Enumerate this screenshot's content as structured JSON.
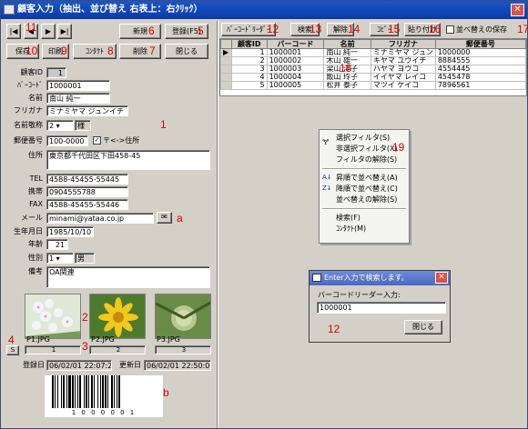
{
  "window": {
    "title": "顧客入力（抽出、並び替え 右表上：右ｸﾘｯｸ）"
  },
  "toolbar": {
    "save": "保存",
    "print": "印刷",
    "contact": "ｺﾝﾀｸﾄ",
    "new": "新規",
    "register": "登録(F5)",
    "delete": "削除",
    "close": "閉じる"
  },
  "right_toolbar": {
    "barcode_reader": "ﾊﾞｰｺｰﾄﾞﾘｰﾀﾞｰ",
    "search": "検索",
    "release": "解除",
    "copy": "ｺﾋﾟｰ",
    "paste": "貼り付け",
    "sort_keep": "並べ替えの保存"
  },
  "form": {
    "id_label": "顧客ID",
    "id_value": "1",
    "barcode_label": "ﾊﾞｰｺｰﾄﾞ",
    "barcode_value": "1000001",
    "name_label": "名前",
    "name_value": "南山 純一",
    "kana_label": "フリガナ",
    "kana_value": "ミナミヤマ ジュンイチ",
    "honorific_label": "名前敬称",
    "honorific_num": "2",
    "honorific_value": "様",
    "postal_label": "郵便番号",
    "postal_value": "100-0000",
    "postal_check": "〒<->住所",
    "address_label": "住所",
    "address_value": "東京都千代田区下田458-45",
    "tel_label": "TEL",
    "tel_value": "4588-45455-55445",
    "mobile_label": "携帯",
    "mobile_value": "0904555788",
    "fax_label": "FAX",
    "fax_value": "4588-45455-55446",
    "email_label": "メール",
    "email_value": "minami@yataa.co.jp",
    "birth_label": "生年月日",
    "birth_value": "1985/10/10",
    "age_label": "年齢",
    "age_value": "21",
    "gender_label": "性別",
    "gender_num": "1",
    "gender_value": "男",
    "notes_label": "備考",
    "notes_value": "OA関連",
    "reg_label": "登録日",
    "reg_value": "06/02/01 22:07:29",
    "upd_label": "更新日",
    "upd_value": "06/02/01 22:50:04",
    "s_button": "S"
  },
  "photos": [
    {
      "caption": "P1.JPG",
      "num": "1"
    },
    {
      "caption": "P2.JPG",
      "num": "2"
    },
    {
      "caption": "P3.JPG",
      "num": "3"
    }
  ],
  "barcode_text": "1 0 0 0 0 0 1",
  "grid": {
    "headers": [
      "顧客ID",
      "バーコード",
      "名前",
      "フリガナ",
      "郵便番号"
    ],
    "rows": [
      [
        "1",
        "1000001",
        "南山 純一",
        "ミナミヤマ ジュン",
        "1000000"
      ],
      [
        "2",
        "1000002",
        "木山 雄一",
        "キヤマ ユウイチ",
        "8884555"
      ],
      [
        "3",
        "1000003",
        "梁山 洋子",
        "ハヤマ ヨウコ",
        "4554445"
      ],
      [
        "4",
        "1000004",
        "飯山 玲子",
        "イイヤマ レイコ",
        "4545478"
      ],
      [
        "5",
        "1000005",
        "松井 泰子",
        "マツイ ケイコ",
        "7896561"
      ]
    ]
  },
  "context_menu": {
    "items": [
      "選択フィルタ(S)",
      "非選択フィルタ(X)",
      "フィルタの解除(S)",
      "昇順で並べ替え(A)",
      "降順で並べ替え(C)",
      "並べ替えの解除(S)",
      "検索(F)",
      "ｺﾝﾀｸﾄ(M)"
    ]
  },
  "dialog": {
    "title": "Enter入力で検索します。",
    "label": "バーコードリーダー入力:",
    "value": "1000001",
    "close": "閉じる"
  },
  "markers": {
    "m1": "1",
    "m2": "2",
    "m3": "3",
    "m4": "4",
    "m5": "5",
    "m6": "6",
    "m7": "7",
    "m8": "8",
    "m9": "9",
    "m10": "10",
    "m11": "11",
    "m12": "12",
    "m13": "13",
    "m14": "14",
    "m15": "15",
    "m16": "16",
    "m17": "17",
    "m18": "18",
    "m19": "19",
    "ma": "a",
    "mb": "b"
  },
  "colors": {
    "titlebar": "#0a3aa8",
    "marker": "#e00000",
    "window_bg": "#d4d0c8"
  }
}
